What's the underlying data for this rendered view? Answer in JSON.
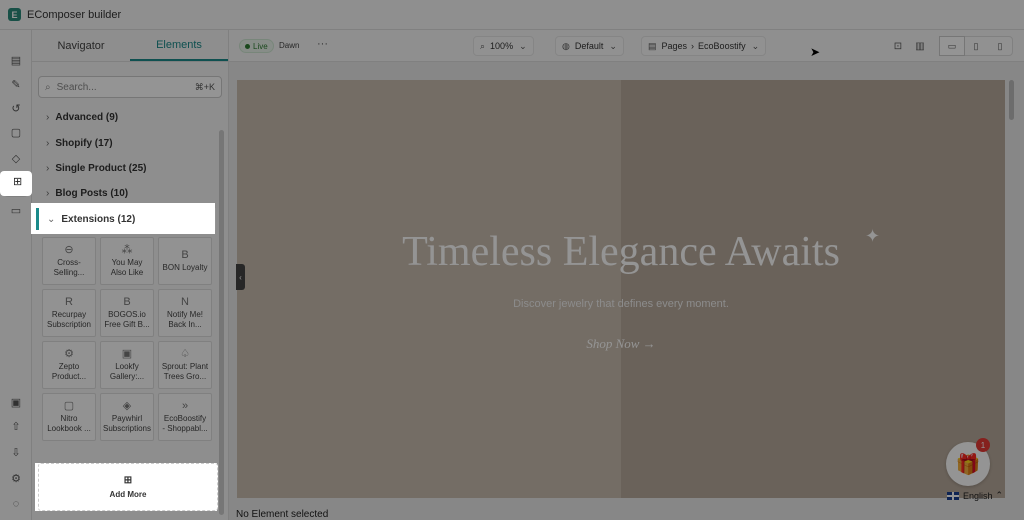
{
  "app": {
    "title": "EComposer builder"
  },
  "rail": {
    "items": [
      "layers-icon",
      "brush-icon",
      "history-icon",
      "clipboard-icon",
      "box-icon",
      "elements-icon",
      "page-icon"
    ],
    "bottom": [
      "folder-icon",
      "upload-icon",
      "download-icon",
      "settings-icon",
      "chat-icon"
    ]
  },
  "panel": {
    "tabs": [
      "Navigator",
      "Elements"
    ],
    "search": {
      "placeholder": "Search...",
      "shortcut": "⌘+K"
    },
    "categories": [
      "Advanced (9)",
      "Shopify (17)",
      "Single Product (25)",
      "Blog Posts (10)",
      "Extensions (12)"
    ],
    "extensions": [
      {
        "label": "Cross-\nSelling...",
        "icon": "cross-sell-icon"
      },
      {
        "label": "You May\nAlso Like",
        "icon": "recommend-icon"
      },
      {
        "label": "BON Loyalty",
        "icon": "bon-icon"
      },
      {
        "label": "Recurpay\nSubscription",
        "icon": "recurpay-icon"
      },
      {
        "label": "BOGOS.io\nFree Gift B...",
        "icon": "bogos-icon"
      },
      {
        "label": "Notify Me!\nBack In...",
        "icon": "notify-icon"
      },
      {
        "label": "Zepto\nProduct...",
        "icon": "zepto-icon"
      },
      {
        "label": "Lookfy\nGallery:...",
        "icon": "gallery-icon"
      },
      {
        "label": "Sprout: Plant\nTrees Gro...",
        "icon": "sprout-icon"
      },
      {
        "label": "Nitro\nLookbook ...",
        "icon": "nitro-icon"
      },
      {
        "label": "Paywhirl\nSubscriptions",
        "icon": "paywhirl-icon"
      },
      {
        "label": "EcoBoostify\n- Shoppabl...",
        "icon": "ecoboostify-icon"
      }
    ],
    "add_more": "Add More"
  },
  "topbar": {
    "live": "Live",
    "theme": "Dawn",
    "zoom": "100%",
    "preset": "Default",
    "pages_label": "Pages",
    "page": "EcoBoostify"
  },
  "hero": {
    "headline": "Timeless Elegance Awaits",
    "subtitle": "Discover jewelry that defines every moment.",
    "cta": "Shop Now →"
  },
  "status": "No Element selected",
  "gift": {
    "badge": "1",
    "language": "English"
  }
}
